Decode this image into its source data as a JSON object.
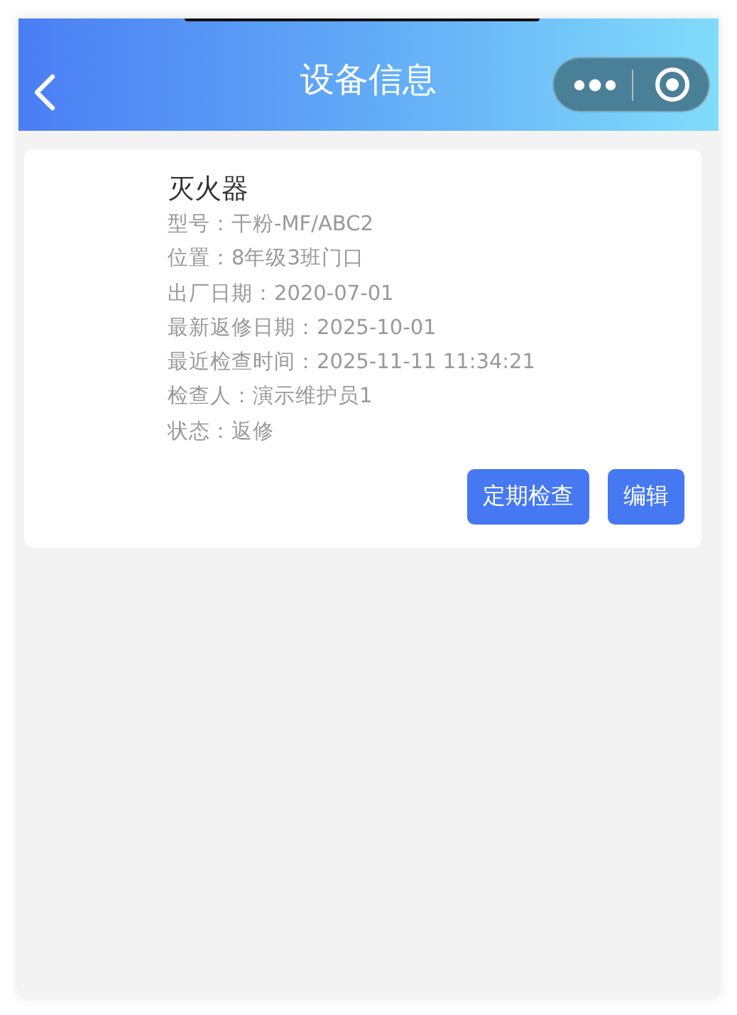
{
  "nav_bar": {
    "title": "设备信息"
  },
  "device_card": {
    "name": "灭火器",
    "details": [
      "型号：干粉-MF/ABC2",
      "位置：8年级3班门口",
      "出厂日期：2020-07-01",
      "最新返修日期：2025-10-01",
      "最近检查时间：2025-11-11 11:34:21",
      "检查人：演示维护员1",
      "状态：返修"
    ],
    "buttons": [
      "定期检查",
      "编辑"
    ]
  }
}
